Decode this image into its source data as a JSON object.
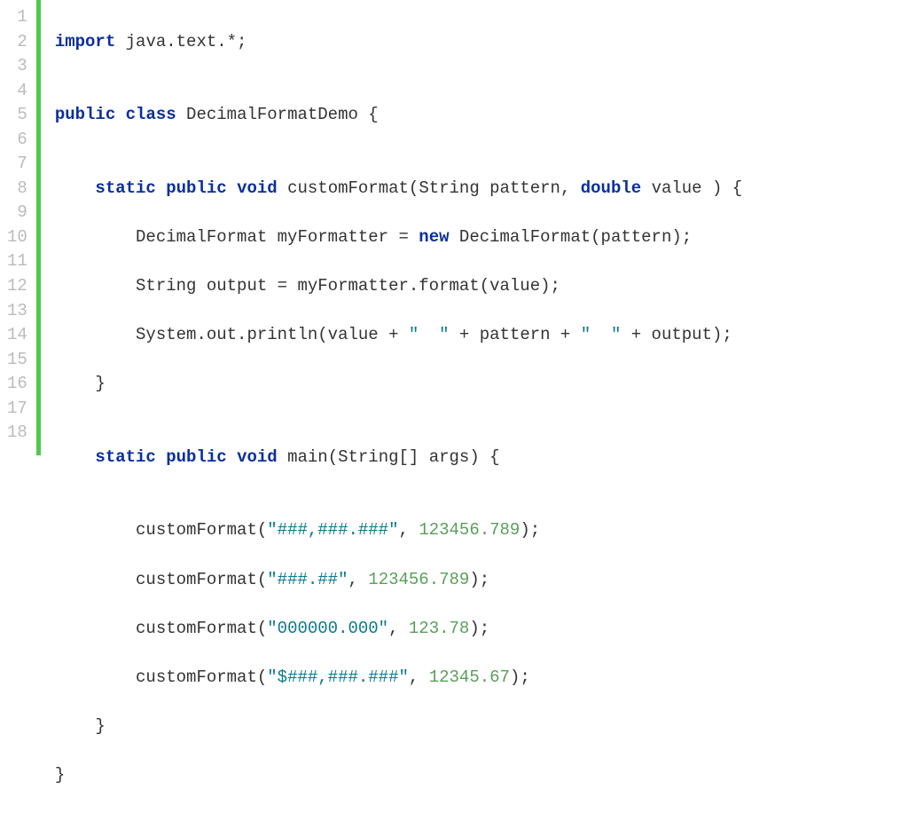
{
  "gutter": [
    "1",
    "2",
    "3",
    "4",
    "5",
    "6",
    "7",
    "8",
    "9",
    "10",
    "11",
    "12",
    "13",
    "14",
    "15",
    "16",
    "17",
    "18"
  ],
  "code": {
    "l1": {
      "kw_import": "import",
      "rest": " java.text.*;"
    },
    "l2": "",
    "l3": {
      "kw_public": "public",
      "sp1": " ",
      "kw_class": "class",
      "rest": " DecimalFormatDemo {"
    },
    "l4": "",
    "l5": {
      "indent": "    ",
      "kw_static": "static",
      "sp1": " ",
      "kw_public": "public",
      "sp2": " ",
      "kw_void": "void",
      "mid": " customFormat(String pattern, ",
      "kw_double": "double",
      "rest": " value ) {"
    },
    "l6": {
      "indent": "        ",
      "a": "DecimalFormat myFormatter = ",
      "kw_new": "new",
      "rest": " DecimalFormat(pattern);"
    },
    "l7": "        String output = myFormatter.format(value);",
    "l8": {
      "indent": "        ",
      "a": "System.out.println(value + ",
      "s1": "\"  \"",
      "b": " + pattern + ",
      "s2": "\"  \"",
      "c": " + output);"
    },
    "l9": "    }",
    "l10": "",
    "l11": {
      "indent": "    ",
      "kw_static": "static",
      "sp1": " ",
      "kw_public": "public",
      "sp2": " ",
      "kw_void": "void",
      "rest": " main(String[] args) {"
    },
    "l12": "",
    "l13": {
      "indent": "        ",
      "a": "customFormat(",
      "s": "\"###,###.###\"",
      "b": ", ",
      "n": "123456.789",
      "c": ");"
    },
    "l14": {
      "indent": "        ",
      "a": "customFormat(",
      "s": "\"###.##\"",
      "b": ", ",
      "n": "123456.789",
      "c": ");"
    },
    "l15": {
      "indent": "        ",
      "a": "customFormat(",
      "s": "\"000000.000\"",
      "b": ", ",
      "n": "123.78",
      "c": ");"
    },
    "l16": {
      "indent": "        ",
      "a": "customFormat(",
      "s": "\"$###,###.###\"",
      "b": ", ",
      "n": "12345.67",
      "c": ");"
    },
    "l17": "    }",
    "l18": "}"
  }
}
